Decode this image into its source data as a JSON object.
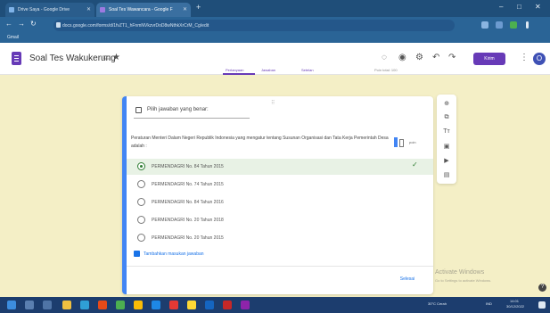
{
  "browser": {
    "tabs": [
      {
        "label": "Drive Saya - Google Drive"
      },
      {
        "label": "Soal Tes Wawancara - Google F"
      }
    ],
    "new_tab": "+",
    "url": "docs.google.com/forms/d/1fvZT1_hFnmNVkzvrDoD8wNthkXrCrM_Cg/edit",
    "bookmark": "Gmail",
    "window_controls": [
      "–",
      "□",
      "✕"
    ]
  },
  "form": {
    "title": "Soal Tes Wakukerung",
    "send_label": "Kirim",
    "avatar_letter": "O",
    "tabs": [
      "Pertanyaan",
      "Jawaban",
      "Setelan"
    ],
    "total_points": "Poin total: 100"
  },
  "question": {
    "type_label": "Pilih jawaban yang benar:",
    "text": "Peraturan Menteri Dalam Negeri Republik Indonesia yang mengatur tentang Susunan Organisasi dan Tata Kerja Pemerintah Desa adalah :",
    "image_points": "poin",
    "options": [
      {
        "label": "PERMENDAGRI No. 84 Tahun 2015",
        "selected": true
      },
      {
        "label": "PERMENDAGRI No. 74 Tahun 2015",
        "selected": false
      },
      {
        "label": "PERMENDAGRI No. 84 Tahun 2016",
        "selected": false
      },
      {
        "label": "PERMENDAGRI No. 20 Tahun 2018",
        "selected": false
      },
      {
        "label": "PERMENDAGRI No. 20 Tahun 2015",
        "selected": false
      }
    ],
    "feedback_label": "Tambahkan masukan jawaban",
    "done_label": "Selesai"
  },
  "side_toolbar": [
    "⊕",
    "⧉",
    "Tт",
    "▣",
    "▶",
    "▤"
  ],
  "watermark": {
    "title": "Activate Windows",
    "subtitle": "Go to Settings to activate Windows."
  },
  "taskbar": {
    "weather": "30°C Cerah",
    "lang": "IND",
    "clock": "14:01",
    "date": "30/12/2022"
  },
  "colors": {
    "accent": "#673ab7",
    "page_bg": "#f4efc6",
    "correct": "#2e7d32",
    "link": "#1a73e8"
  }
}
